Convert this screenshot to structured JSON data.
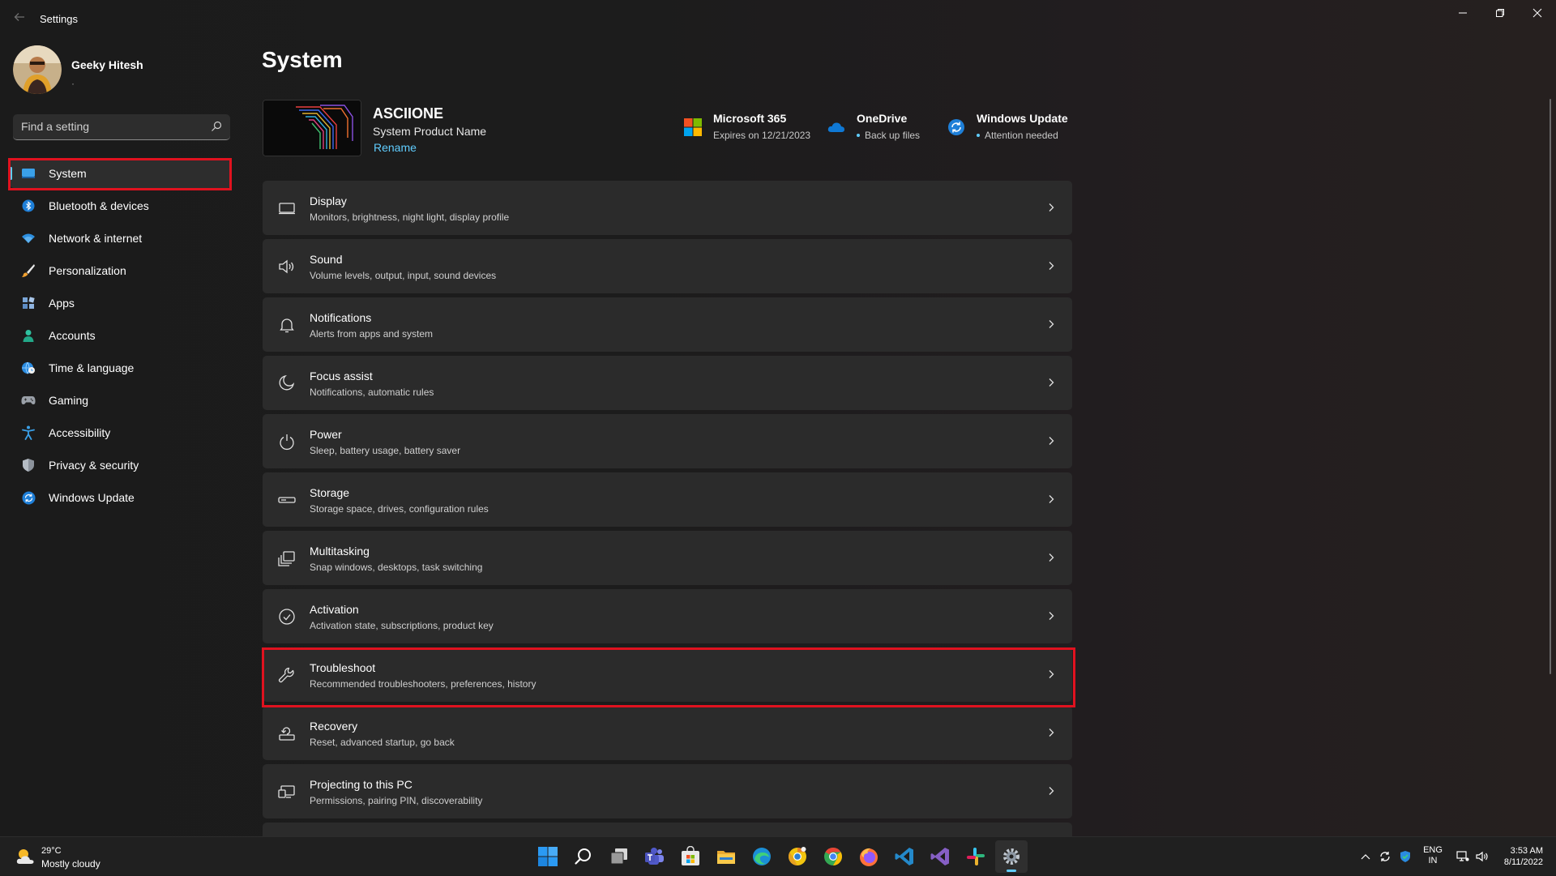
{
  "window": {
    "title": "Settings",
    "controls": [
      "minimize-icon",
      "maximize-icon",
      "close-icon"
    ]
  },
  "profile": {
    "name": "Geeky Hitesh",
    "sub": "·"
  },
  "search": {
    "placeholder": "Find a setting"
  },
  "sidebar": {
    "items": [
      {
        "label": "System",
        "icon": "monitor-icon",
        "selected": true
      },
      {
        "label": "Bluetooth & devices",
        "icon": "bluetooth-icon"
      },
      {
        "label": "Network & internet",
        "icon": "wifi-icon"
      },
      {
        "label": "Personalization",
        "icon": "brush-icon"
      },
      {
        "label": "Apps",
        "icon": "apps-icon"
      },
      {
        "label": "Accounts",
        "icon": "person-icon"
      },
      {
        "label": "Time & language",
        "icon": "globe-clock-icon"
      },
      {
        "label": "Gaming",
        "icon": "gamepad-icon"
      },
      {
        "label": "Accessibility",
        "icon": "accessibility-icon"
      },
      {
        "label": "Privacy & security",
        "icon": "shield-icon"
      },
      {
        "label": "Windows Update",
        "icon": "update-icon"
      }
    ]
  },
  "main": {
    "title": "System",
    "device": {
      "name": "ASCIIONE",
      "model": "System Product Name",
      "rename": "Rename"
    },
    "status": [
      {
        "title": "Microsoft 365",
        "sub": "Expires on 12/21/2023",
        "icon": "microsoft-logo-icon"
      },
      {
        "title": "OneDrive",
        "sub": "Back up files",
        "icon": "onedrive-cloud-icon"
      },
      {
        "title": "Windows Update",
        "sub": "Attention needed",
        "icon": "update-icon"
      }
    ],
    "cards": [
      {
        "title": "Display",
        "sub": "Monitors, brightness, night light, display profile",
        "icon": "display-icon"
      },
      {
        "title": "Sound",
        "sub": "Volume levels, output, input, sound devices",
        "icon": "speaker-icon"
      },
      {
        "title": "Notifications",
        "sub": "Alerts from apps and system",
        "icon": "bell-icon"
      },
      {
        "title": "Focus assist",
        "sub": "Notifications, automatic rules",
        "icon": "moon-icon"
      },
      {
        "title": "Power",
        "sub": "Sleep, battery usage, battery saver",
        "icon": "power-icon"
      },
      {
        "title": "Storage",
        "sub": "Storage space, drives, configuration rules",
        "icon": "storage-drive-icon"
      },
      {
        "title": "Multitasking",
        "sub": "Snap windows, desktops, task switching",
        "icon": "multitask-icon"
      },
      {
        "title": "Activation",
        "sub": "Activation state, subscriptions, product key",
        "icon": "check-circle-icon"
      },
      {
        "title": "Troubleshoot",
        "sub": "Recommended troubleshooters, preferences, history",
        "icon": "wrench-icon"
      },
      {
        "title": "Recovery",
        "sub": "Reset, advanced startup, go back",
        "icon": "recovery-icon"
      },
      {
        "title": "Projecting to this PC",
        "sub": "Permissions, pairing PIN, discoverability",
        "icon": "projector-icon"
      }
    ]
  },
  "taskbar": {
    "weather": {
      "temp": "29°C",
      "desc": "Mostly cloudy",
      "icon": "partly-cloudy-icon"
    },
    "apps": [
      "start-icon",
      "search-icon",
      "task-view-icon",
      "teams-icon",
      "store-icon",
      "file-explorer-icon",
      "edge-icon",
      "chrome-canary-icon",
      "chrome-icon",
      "firefox-icon",
      "vscode-icon",
      "visual-studio-icon",
      "slack-icon",
      "settings-gear-icon"
    ],
    "active_app": "settings-gear-icon",
    "tray": {
      "lang": {
        "line1": "ENG",
        "line2": "IN"
      },
      "time": "3:53 AM",
      "date": "8/11/2022"
    }
  },
  "colors": {
    "accent": "#60cdff",
    "highlight": "#e0121f",
    "card": "#2b2b2b",
    "background": "#1c1c1c"
  }
}
